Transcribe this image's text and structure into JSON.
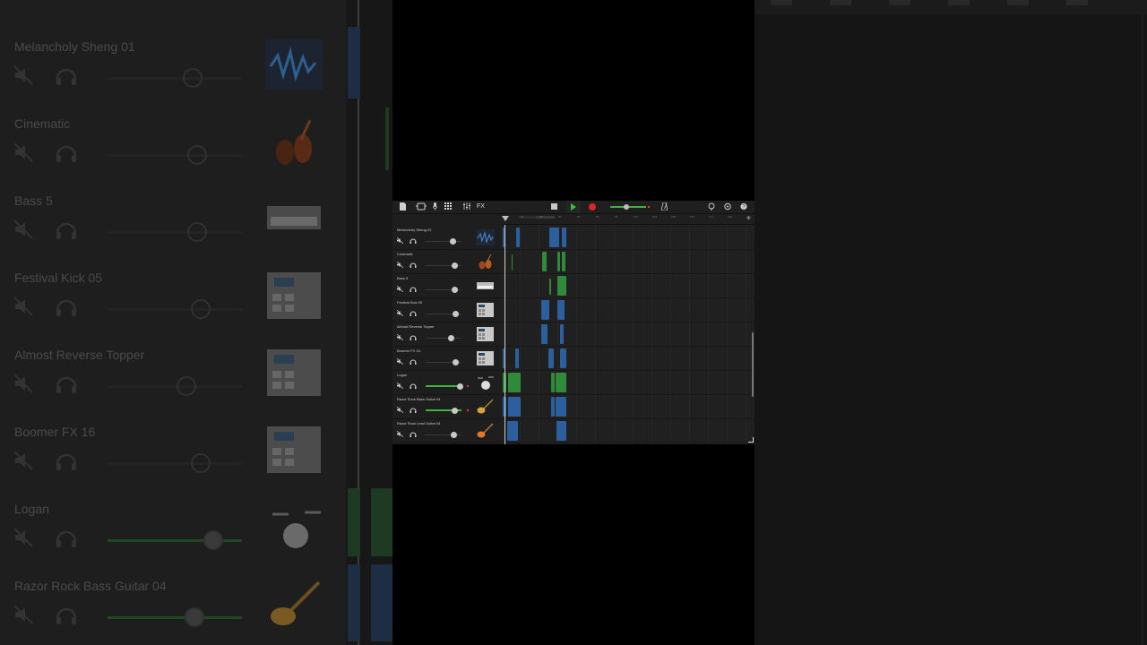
{
  "toolbar": {
    "fx_label": "FX"
  },
  "ruler": {
    "bars": [
      "1",
      "17",
      "33",
      "49",
      "65",
      "81",
      "97",
      "113",
      "129",
      "145",
      "161",
      "177",
      "193",
      "209",
      "225"
    ]
  },
  "tracks": [
    {
      "name": "Melancholy Sheng 01",
      "icon": "waveform-icon"
    },
    {
      "name": "Cinematic",
      "icon": "violin-icon"
    },
    {
      "name": "Bass 5",
      "icon": "synth-keyboard-icon"
    },
    {
      "name": "Festival Kick 05",
      "icon": "drum-machine-icon"
    },
    {
      "name": "Almost Reverse Topper",
      "icon": "drum-machine-icon"
    },
    {
      "name": "Boomer FX 16",
      "icon": "drum-machine-icon"
    },
    {
      "name": "Logan",
      "icon": "drum-kit-icon"
    },
    {
      "name": "Razor Rock Bass Guitar 04",
      "icon": "bass-guitar-icon"
    },
    {
      "name": "Razor Rock Lead Guitar 04",
      "icon": "electric-guitar-icon"
    }
  ],
  "colors": {
    "audio_region": "#2b5f9e",
    "midi_region": "#2f8a3a",
    "volume_active": "#3fb33f",
    "record": "#e02424",
    "play": "#35c535"
  }
}
